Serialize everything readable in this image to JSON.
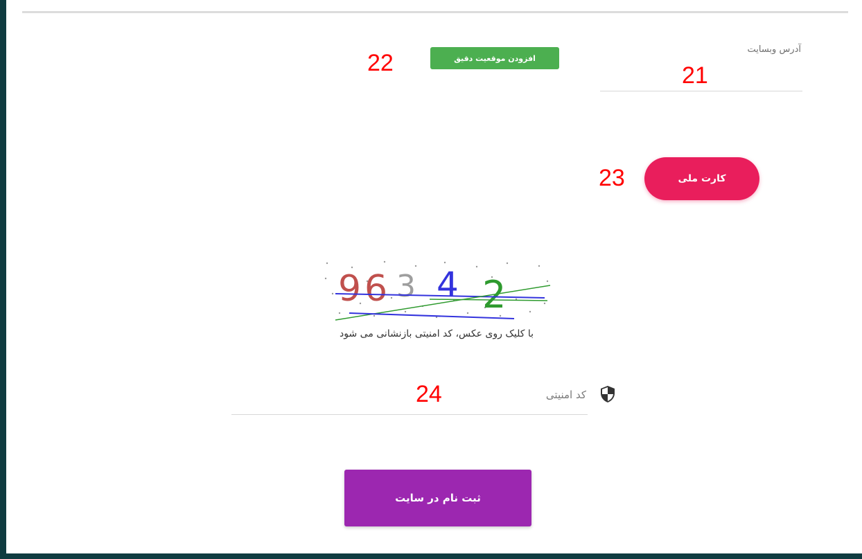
{
  "website": {
    "label": "آدرس وبسایت",
    "value": ""
  },
  "geo_button": {
    "label": "افزودن موقعیت دقیق"
  },
  "national_card_button": {
    "label": "کارت ملی"
  },
  "captcha": {
    "digits": [
      "9",
      "6",
      "3",
      "4",
      "2"
    ],
    "digit_colors": [
      "#c0504d",
      "#c0504d",
      "#9e9e9e",
      "#3333dd",
      "#2e9a2e"
    ],
    "hint": "با کلیک روی عکس، کد امنیتی بازنشانی می شود"
  },
  "security_code": {
    "placeholder": "کد امنیتی",
    "icon": "shield-icon"
  },
  "submit_button": {
    "label": "ثبت نام در سایت"
  },
  "markers": {
    "m21": "21",
    "m22": "22",
    "m23": "23",
    "m24": "24"
  },
  "colors": {
    "geo_button": "#4caf50",
    "national_card_button": "#e91e5c",
    "submit_button": "#9c27b0",
    "frame": "#0f3b40"
  }
}
